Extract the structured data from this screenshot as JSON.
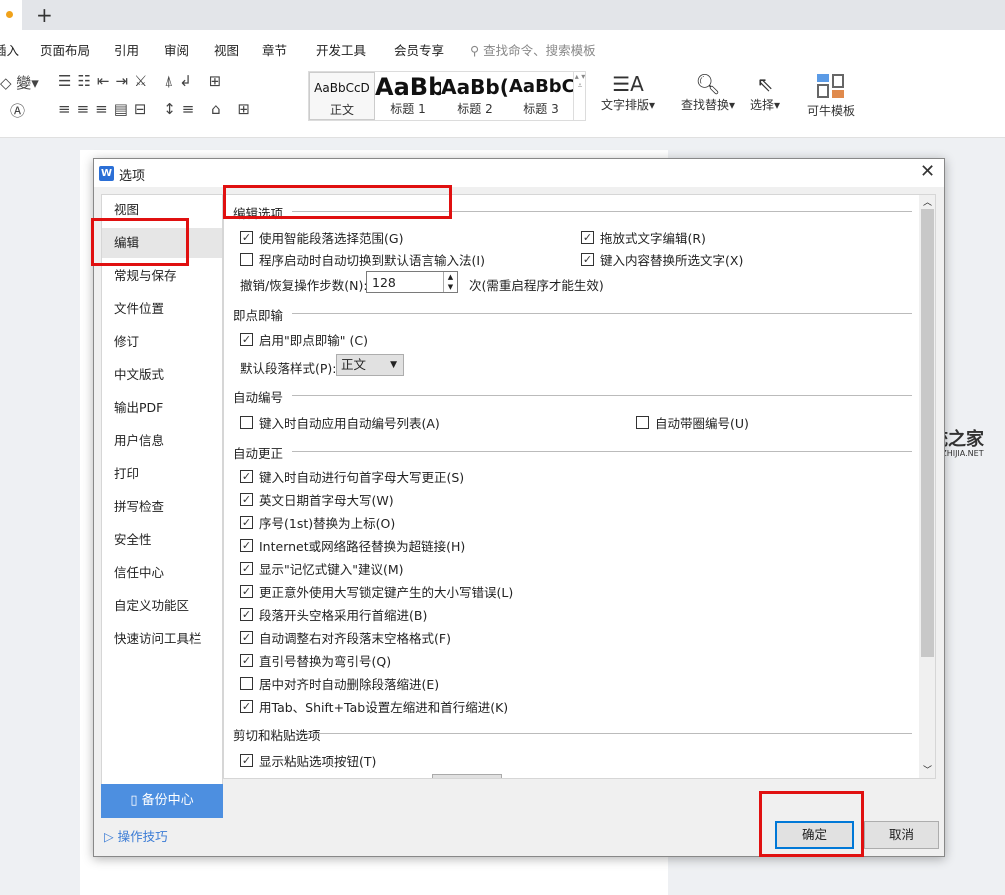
{
  "tabbar": {
    "new_tab": "+"
  },
  "menu": [
    "插入",
    "页面布局",
    "引用",
    "审阅",
    "视图",
    "章节",
    "开发工具",
    "会员专享"
  ],
  "search_placeholder": "查找命令、搜索模板",
  "styles": [
    {
      "sample": "AaBbCcD",
      "label": "正文"
    },
    {
      "sample": "AaBb",
      "label": "标题 1"
    },
    {
      "sample": "AaBb(",
      "label": "标题 2"
    },
    {
      "sample": "AaBbC",
      "label": "标题 3"
    }
  ],
  "toolbar_buttons": {
    "text_layout": "文字排版",
    "find_replace": "查找替换",
    "select": "选择",
    "template": "可牛模板"
  },
  "dialog": {
    "title": "选项",
    "nav": [
      "视图",
      "编辑",
      "常规与保存",
      "文件位置",
      "修订",
      "中文版式",
      "输出PDF",
      "用户信息",
      "打印",
      "拼写检查",
      "安全性",
      "信任中心",
      "自定义功能区",
      "快速访问工具栏"
    ],
    "selected_nav": "编辑",
    "backup": "备份中心",
    "tips": "操作技巧",
    "sections": {
      "edit": "编辑选项",
      "click_type": "即点即输",
      "auto_number": "自动编号",
      "autocorrect": "自动更正",
      "cut_paste": "剪切和粘贴选项"
    },
    "edit_options": [
      {
        "label": "使用智能段落选择范围(G)",
        "checked": true
      },
      {
        "label": "程序启动时自动切换到默认语言输入法(I)",
        "checked": false
      },
      {
        "label": "拖放式文字编辑(R)",
        "checked": true
      },
      {
        "label": "键入内容替换所选文字(X)",
        "checked": true
      }
    ],
    "undo_label": "撤销/恢复操作步数(N):",
    "undo_value": "128",
    "undo_note": "次(需重启程序才能生效)",
    "click_type_enable": {
      "label": "启用\"即点即输\" (C)",
      "checked": true
    },
    "default_style_label": "默认段落样式(P):",
    "default_style_value": "正文",
    "auto_number_options": [
      {
        "label": "键入时自动应用自动编号列表(A)",
        "checked": false
      },
      {
        "label": "自动带圈编号(U)",
        "checked": false
      }
    ],
    "autocorrect_options": [
      {
        "label": "键入时自动进行句首字母大写更正(S)",
        "checked": true
      },
      {
        "label": "英文日期首字母大写(W)",
        "checked": true
      },
      {
        "label": "序号(1st)替换为上标(O)",
        "checked": true
      },
      {
        "label": "Internet或网络路径替换为超链接(H)",
        "checked": true
      },
      {
        "label": "显示\"记忆式键入\"建议(M)",
        "checked": true
      },
      {
        "label": "更正意外使用大写锁定键产生的大小写错误(L)",
        "checked": true
      },
      {
        "label": "段落开头空格采用行首缩进(B)",
        "checked": true
      },
      {
        "label": "自动调整右对齐段落末空格格式(F)",
        "checked": true
      },
      {
        "label": "直引号替换为弯引号(Q)",
        "checked": true
      },
      {
        "label": "居中对齐时自动删除段落缩进(E)",
        "checked": false
      },
      {
        "label": "用Tab、Shift+Tab设置左缩进和首行缩进(K)",
        "checked": true
      }
    ],
    "cut_paste_options": [
      {
        "label": "显示粘贴选项按钮(T)",
        "checked": true
      }
    ],
    "ok": "确定",
    "cancel": "取消"
  },
  "watermark": {
    "name": "系统之家",
    "url": "XITONGZHIJIA.NET"
  },
  "colors": {
    "accent": "#4d8fe0",
    "highlight": "#e01010"
  }
}
